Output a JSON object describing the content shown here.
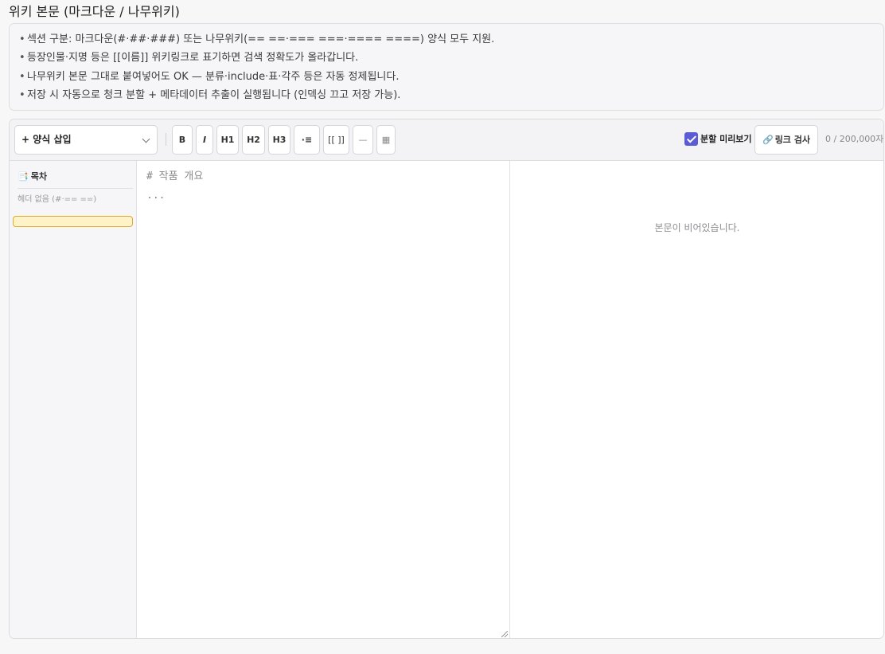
{
  "page": {
    "title": "위키 본문 (마크다운 / 나무위키)"
  },
  "notice": {
    "bullet": "•",
    "lines": [
      "섹션 구분: 마크다운(#·##·###) 또는 나무위키(== ==·=== ===·==== ====) 양식 모두 지원.",
      "등장인물·지명 등은 [[이름]] 위키링크로 표기하면 검색 정확도가 올라갑니다.",
      "나무위키 본문 그대로 붙여넣어도 OK — 분류·include·표·각주 등은 자동 정제됩니다.",
      "저장 시 자동으로 청크 분할 + 메타데이터 추출이 실행됩니다 (인덱싱 끄고 저장 가능)."
    ]
  },
  "toolbar": {
    "template_select": "+ 양식 삽입",
    "buttons": {
      "bold": "B",
      "italic": "I",
      "h1": "H1",
      "h2": "H2",
      "h3": "H3",
      "list": "·≡",
      "wikilink": "[[ ]]",
      "hr": "—",
      "table": "▦"
    },
    "preview_toggle": {
      "label": "분할 미리보기",
      "checked": true
    },
    "link_check": {
      "icon": "🔗",
      "label": "링크 검사"
    },
    "char_count": "0 / 200,000자"
  },
  "toc": {
    "icon": "📑",
    "title": "목차",
    "empty": "헤더 없음 (#·== ==)"
  },
  "source": {
    "placeholder_line1": "# 작품 개요",
    "placeholder_line2": "..."
  },
  "preview": {
    "empty": "본문이 비어있습니다."
  },
  "colors": {
    "accent": "#5b5bd6",
    "highlight_fill": "#fef3c7",
    "highlight_border": "#e0a92f"
  }
}
